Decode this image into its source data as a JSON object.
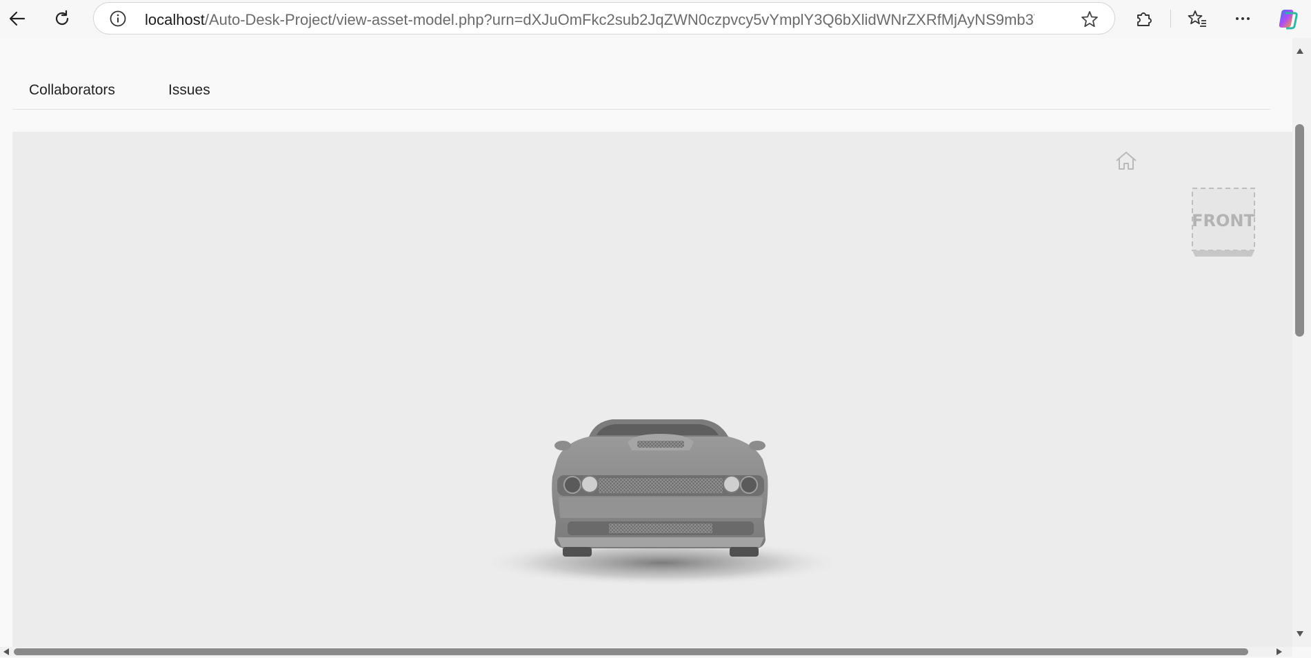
{
  "browser": {
    "url_host": "localhost",
    "url_path": "/Auto-Desk-Project/view-asset-model.php?urn=dXJuOmFkc2sub2JqZWN0czpvcy5vYmplY3Q6bXlidWNrZXRfMjAyNS9mb3VyLm9i..."
  },
  "tabs": [
    {
      "label": "Collaborators"
    },
    {
      "label": "Issues"
    }
  ],
  "viewer": {
    "viewcube_face": "FRONT",
    "home_icon": "home-icon"
  }
}
